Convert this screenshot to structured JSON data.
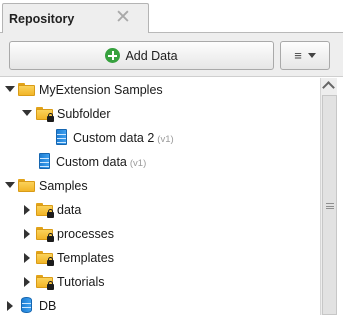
{
  "panel": {
    "tab_title": "Repository",
    "close_symbol": "✕"
  },
  "toolbar": {
    "add_data_label": "Add Data",
    "menu_symbol": "≡"
  },
  "tree": {
    "items": [
      {
        "label": "MyExtension Samples",
        "type": "folder",
        "locked": false,
        "expanded": true
      },
      {
        "label": "Subfolder",
        "type": "folder",
        "locked": true,
        "expanded": true
      },
      {
        "label": "Custom data 2",
        "version": "(v1)",
        "type": "data"
      },
      {
        "label": "Custom data",
        "version": "(v1)",
        "type": "data"
      },
      {
        "label": "Samples",
        "type": "folder",
        "locked": false,
        "expanded": true
      },
      {
        "label": "data",
        "type": "folder",
        "locked": true,
        "expanded": false
      },
      {
        "label": "processes",
        "type": "folder",
        "locked": true,
        "expanded": false
      },
      {
        "label": "Templates",
        "type": "folder",
        "locked": true,
        "expanded": false
      },
      {
        "label": "Tutorials",
        "type": "folder",
        "locked": true,
        "expanded": false
      },
      {
        "label": "DB",
        "type": "database",
        "expanded": false
      }
    ]
  },
  "colors": {
    "folder": "#f2b528",
    "data": "#2f8fe3",
    "add_icon": "#36a13e"
  }
}
